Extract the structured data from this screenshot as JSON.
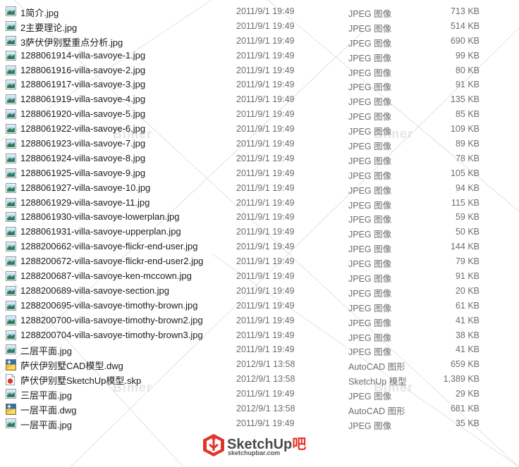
{
  "files": [
    {
      "name": "1简介.jpg",
      "date": "2011/9/1 19:49",
      "type": "JPEG 图像",
      "size": "713 KB",
      "icon": "jpeg-image-icon"
    },
    {
      "name": "2主要理论.jpg",
      "date": "2011/9/1 19:49",
      "type": "JPEG 图像",
      "size": "514 KB",
      "icon": "jpeg-image-icon"
    },
    {
      "name": "3萨伏伊别墅重点分析.jpg",
      "date": "2011/9/1 19:49",
      "type": "JPEG 图像",
      "size": "690 KB",
      "icon": "jpeg-image-icon"
    },
    {
      "name": "1288061914-villa-savoye-1.jpg",
      "date": "2011/9/1 19:49",
      "type": "JPEG 图像",
      "size": "99 KB",
      "icon": "jpeg-image-icon"
    },
    {
      "name": "1288061916-villa-savoye-2.jpg",
      "date": "2011/9/1 19:49",
      "type": "JPEG 图像",
      "size": "80 KB",
      "icon": "jpeg-image-icon"
    },
    {
      "name": "1288061917-villa-savoye-3.jpg",
      "date": "2011/9/1 19:49",
      "type": "JPEG 图像",
      "size": "91 KB",
      "icon": "jpeg-image-icon"
    },
    {
      "name": "1288061919-villa-savoye-4.jpg",
      "date": "2011/9/1 19:49",
      "type": "JPEG 图像",
      "size": "135 KB",
      "icon": "jpeg-image-icon"
    },
    {
      "name": "1288061920-villa-savoye-5.jpg",
      "date": "2011/9/1 19:49",
      "type": "JPEG 图像",
      "size": "85 KB",
      "icon": "jpeg-image-icon"
    },
    {
      "name": "1288061922-villa-savoye-6.jpg",
      "date": "2011/9/1 19:49",
      "type": "JPEG 图像",
      "size": "109 KB",
      "icon": "jpeg-image-icon"
    },
    {
      "name": "1288061923-villa-savoye-7.jpg",
      "date": "2011/9/1 19:49",
      "type": "JPEG 图像",
      "size": "89 KB",
      "icon": "jpeg-image-icon"
    },
    {
      "name": "1288061924-villa-savoye-8.jpg",
      "date": "2011/9/1 19:49",
      "type": "JPEG 图像",
      "size": "78 KB",
      "icon": "jpeg-image-icon"
    },
    {
      "name": "1288061925-villa-savoye-9.jpg",
      "date": "2011/9/1 19:49",
      "type": "JPEG 图像",
      "size": "105 KB",
      "icon": "jpeg-image-icon"
    },
    {
      "name": "1288061927-villa-savoye-10.jpg",
      "date": "2011/9/1 19:49",
      "type": "JPEG 图像",
      "size": "94 KB",
      "icon": "jpeg-image-icon"
    },
    {
      "name": "1288061929-villa-savoye-11.jpg",
      "date": "2011/9/1 19:49",
      "type": "JPEG 图像",
      "size": "115 KB",
      "icon": "jpeg-image-icon"
    },
    {
      "name": "1288061930-villa-savoye-lowerplan.jpg",
      "date": "2011/9/1 19:49",
      "type": "JPEG 图像",
      "size": "59 KB",
      "icon": "jpeg-image-icon"
    },
    {
      "name": "1288061931-villa-savoye-upperplan.jpg",
      "date": "2011/9/1 19:49",
      "type": "JPEG 图像",
      "size": "50 KB",
      "icon": "jpeg-image-icon"
    },
    {
      "name": "1288200662-villa-savoye-flickr-end-user.jpg",
      "date": "2011/9/1 19:49",
      "type": "JPEG 图像",
      "size": "144 KB",
      "icon": "jpeg-image-icon"
    },
    {
      "name": "1288200672-villa-savoye-flickr-end-user2.jpg",
      "date": "2011/9/1 19:49",
      "type": "JPEG 图像",
      "size": "79 KB",
      "icon": "jpeg-image-icon"
    },
    {
      "name": "1288200687-villa-savoye-ken-mccown.jpg",
      "date": "2011/9/1 19:49",
      "type": "JPEG 图像",
      "size": "91 KB",
      "icon": "jpeg-image-icon"
    },
    {
      "name": "1288200689-villa-savoye-section.jpg",
      "date": "2011/9/1 19:49",
      "type": "JPEG 图像",
      "size": "20 KB",
      "icon": "jpeg-image-icon"
    },
    {
      "name": "1288200695-villa-savoye-timothy-brown.jpg",
      "date": "2011/9/1 19:49",
      "type": "JPEG 图像",
      "size": "61 KB",
      "icon": "jpeg-image-icon"
    },
    {
      "name": "1288200700-villa-savoye-timothy-brown2.jpg",
      "date": "2011/9/1 19:49",
      "type": "JPEG 图像",
      "size": "41 KB",
      "icon": "jpeg-image-icon"
    },
    {
      "name": "1288200704-villa-savoye-timothy-brown3.jpg",
      "date": "2011/9/1 19:49",
      "type": "JPEG 图像",
      "size": "38 KB",
      "icon": "jpeg-image-icon"
    },
    {
      "name": "二层平面.jpg",
      "date": "2011/9/1 19:49",
      "type": "JPEG 图像",
      "size": "41 KB",
      "icon": "jpeg-image-icon"
    },
    {
      "name": "萨伏伊别墅CAD模型.dwg",
      "date": "2012/9/1 13:58",
      "type": "AutoCAD 图形",
      "size": "659 KB",
      "icon": "autocad-drawing-icon"
    },
    {
      "name": "萨伏伊别墅SketchUp模型.skp",
      "date": "2012/9/1 13:58",
      "type": "SketchUp 模型",
      "size": "1,389 KB",
      "icon": "sketchup-model-icon"
    },
    {
      "name": "三层平面.jpg",
      "date": "2011/9/1 19:49",
      "type": "JPEG 图像",
      "size": "29 KB",
      "icon": "jpeg-image-icon"
    },
    {
      "name": "一层平面.dwg",
      "date": "2012/9/1 13:58",
      "type": "AutoCAD 图形",
      "size": "681 KB",
      "icon": "autocad-drawing-icon"
    },
    {
      "name": "一层平面.jpg",
      "date": "2011/9/1 19:49",
      "type": "JPEG 图像",
      "size": "35 KB",
      "icon": "jpeg-image-icon"
    }
  ],
  "watermarks": {
    "text": "Bimer"
  },
  "logo": {
    "brand_main": "SketchUp",
    "brand_accent": "吧",
    "url": "sketchupbar.com"
  },
  "colors": {
    "name_text": "#1b1b1b",
    "meta_text": "#6d6d6d",
    "logo_red": "#e3342b"
  }
}
